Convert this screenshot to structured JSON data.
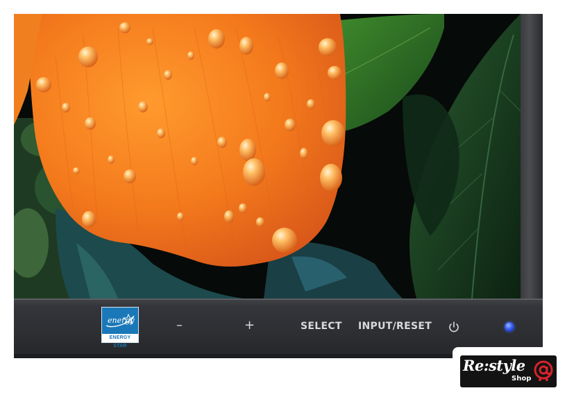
{
  "image": {
    "description_subject": "monitor-bezel-closeup"
  },
  "energy_star": {
    "script_text": "energy",
    "label": "ENERGY STAR"
  },
  "controls": {
    "minus_label": "–",
    "plus_label": "+",
    "select_label": "SELECT",
    "input_reset_label": "INPUT/RESET",
    "power_icon": "power-icon",
    "led_color": "#3d63f2"
  },
  "watermark": {
    "brand_main": "Re:style",
    "brand_sub": "Shop",
    "icon": "at-cart-icon",
    "accent_color": "#d8232a"
  },
  "colors": {
    "petal": "#f07a1e",
    "leaf": "#2f6b2a",
    "bezel": "#2e2f32"
  }
}
